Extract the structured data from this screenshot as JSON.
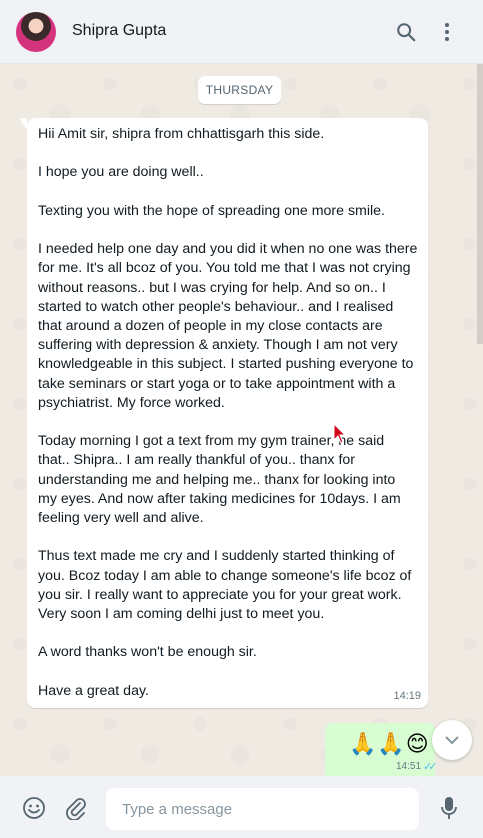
{
  "header": {
    "contact_name": "Shipra Gupta",
    "icons": [
      "search-icon",
      "menu-icon"
    ]
  },
  "chat": {
    "day_label": "THURSDAY",
    "incoming": {
      "text": "Hii Amit sir, shipra from chhattisgarh this side.\n\nI hope you are doing well..\n\nTexting you with the hope of spreading one more smile.\n\nI needed help one day and you did it when no one was there for me. It's all bcoz of you. You told me that I was not crying without reasons.. but I was crying for help. And so on.. I started to watch other people's behaviour.. and I realised that around a dozen of people in my close contacts are suffering with depression & anxiety. Though I am not very knowledgeable in this subject. I started pushing everyone to take seminars or start yoga or to take appointment with a psychiatrist. My force worked.\n\nToday morning I got a text from my gym trainer, he said that.. Shipra.. I am really thankful of you.. thanx for understanding me and helping me.. thanx for looking into my eyes. And now after taking medicines for 10days. I am feeling very well and alive.\n\nThus text made me cry and I suddenly started thinking of you. Bcoz today I am able to change someone's life bcoz of you sir. I really want to appreciate you for your great work. Very soon I am coming delhi just to meet you.\n\nA word thanks won't be enough sir.\n\nHave a great day.",
      "time": "14:19"
    },
    "outgoing": {
      "emojis": "🙏🙏😊",
      "time": "14:51",
      "ticks": "✓✓",
      "tick_color": "#53bdeb"
    }
  },
  "footer": {
    "placeholder": "Type a message",
    "value": ""
  },
  "colors": {
    "header_bg": "#f0f2f5",
    "chat_bg": "#efeae2",
    "incoming_bubble": "#ffffff",
    "outgoing_bubble": "#d9fdd3",
    "icon": "#54656f"
  }
}
